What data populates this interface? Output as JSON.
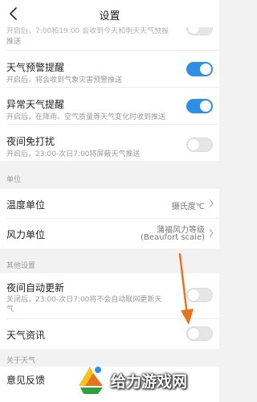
{
  "header": {
    "title": "设置"
  },
  "peek": {
    "cut_line": "开启后，7:00和19:00 会收到今天和明天天气预报",
    "line2": "推送"
  },
  "rows": {
    "warning": {
      "title": "天气预警提醒",
      "subtitle": "开启后，将会收到气象灾害预警推送",
      "state": "on"
    },
    "abnormal": {
      "title": "异常天气提醒",
      "subtitle": "开启后，在降雨、空气质量等天气变化时收到推送",
      "state": "on"
    },
    "night_dnd": {
      "title": "夜间免打扰",
      "subtitle": "开启后，23:00-次日7:00将屏蔽天气推送",
      "state": "off"
    }
  },
  "units": {
    "header": "单位",
    "temperature": {
      "title": "温度单位",
      "value": "摄氏度℃"
    },
    "wind": {
      "title": "风力单位",
      "value_line1": "蒲福风力等级",
      "value_line2": "(Beaufort scale)"
    }
  },
  "other": {
    "header": "其他设置",
    "night_update": {
      "title": "夜间自动更新",
      "subtitle_line1": "关闭后，23:00-次日7:00将不会自动联网更新天",
      "subtitle_line2": "气",
      "state": "off"
    },
    "news": {
      "title": "天气资讯",
      "state": "off"
    }
  },
  "about": {
    "header": "关于天气",
    "feedback": {
      "title": "意见反馈"
    }
  },
  "watermark": {
    "text": "给力游戏网"
  },
  "colors": {
    "toggle_on": "#2f8fe6",
    "annotation_arrow": "#e8731f"
  }
}
